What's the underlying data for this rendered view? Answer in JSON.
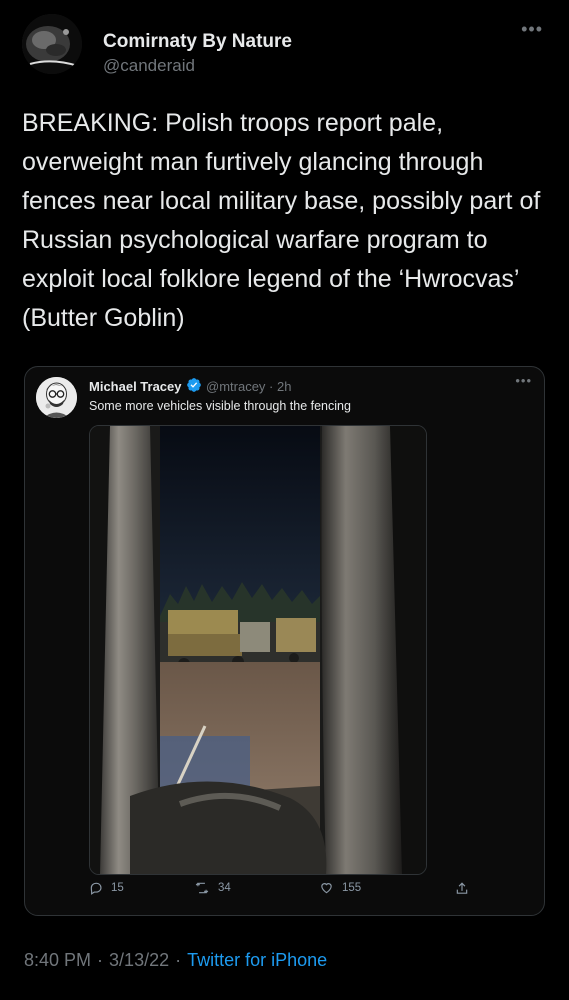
{
  "tweet": {
    "author": {
      "name": "Comirnaty By Nature",
      "handle": "@canderaid"
    },
    "text": "BREAKING: Polish troops report pale, overweight man furtively glancing through fences near local military base, possibly part of Russian psychological warfare program to exploit local folklore legend of the ‘Hwrocvas’ (Butter Goblin)",
    "time": "8:40 PM",
    "date": "3/13/22",
    "source": "Twitter for iPhone"
  },
  "quote": {
    "name": "Michael Tracey",
    "handle": "@mtracey",
    "age": "2h",
    "text": "Some more vehicles visible through the fencing",
    "replies": "15",
    "retweets": "34",
    "likes": "155"
  },
  "colors": {
    "background": "#000000",
    "text": "#e7e9ea",
    "secondary": "#71767b",
    "link": "#1d9bf0",
    "verified": "#1d9bf0"
  },
  "icons": {
    "more": "more-horizontal-icon",
    "verified": "verified-badge-icon",
    "reply": "reply-icon",
    "retweet": "retweet-icon",
    "like": "heart-icon",
    "share": "share-icon"
  }
}
